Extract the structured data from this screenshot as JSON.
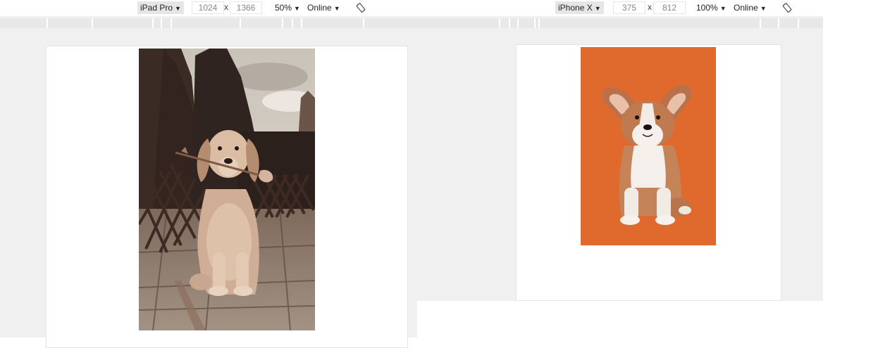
{
  "left_panel": {
    "device": "iPad Pro",
    "width": "1024",
    "height": "1366",
    "times_symbol": "x",
    "zoom": "50%",
    "network": "Online",
    "rotate_icon": "rotate-icon",
    "image_icon": "photo-golden-retriever"
  },
  "right_panel": {
    "device": "iPhone X",
    "width": "375",
    "height": "812",
    "times_symbol": "x",
    "zoom": "100%",
    "network": "Online",
    "rotate_icon": "rotate-icon",
    "image_icon": "photo-corgi-puppy"
  },
  "caret_glyph": "▼",
  "colors": {
    "chrome_bg": "#f0f0f0",
    "ruler": "#e8e8e8",
    "selector_bg": "#e6e6e6",
    "corgi_bg": "#e06a2e"
  }
}
